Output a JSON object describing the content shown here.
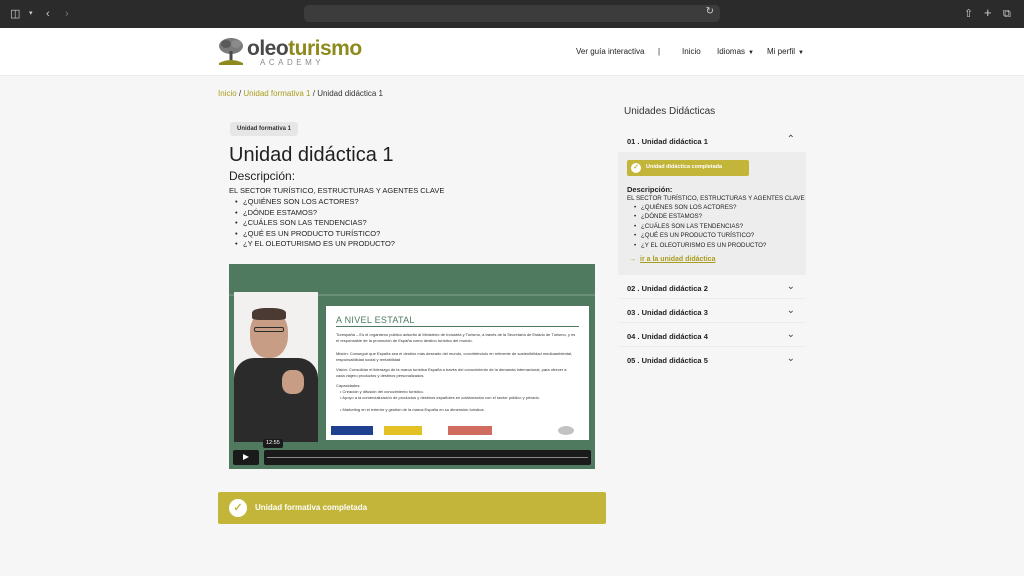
{
  "header": {
    "logo": {
      "part1": "oleo",
      "part2": "turismo",
      "sub": "ACADEMY"
    },
    "nav": {
      "guide": "Ver guía interactiva",
      "separator": "|",
      "home": "Inicio",
      "languages": "Idiomas",
      "profile": "Mi perfil"
    }
  },
  "breadcrumb": {
    "home": "Inicio",
    "sep1": " / ",
    "unit": "Unidad formativa 1",
    "sep2": " / ",
    "current": "Unidad didáctica 1"
  },
  "main": {
    "pill": "Unidad formativa 1",
    "title": "Unidad didáctica 1",
    "desc_label": "Descripción:",
    "desc_heading": "EL SECTOR TURÍSTICO, ESTRUCTURAS Y AGENTES CLAVE",
    "desc_items": [
      "¿QUIÉNES SON LOS ACTORES?",
      "¿DÓNDE ESTAMOS?",
      "¿CUÁLES SON LAS TENDENCIAS?",
      "¿QUÉ ES UN PRODUCTO TURÍSTICO?",
      "¿Y EL OLEOTURISMO ES UN PRODUCTO?"
    ],
    "video": {
      "time": "12:55",
      "slide_title": "A NIVEL ESTATAL",
      "p1": "Turespaña – Es el organismo público adscrito al Ministerio de Industria y Turismo, a través de la Secretaría de Estado de Turismo, y es el responsable de la promoción de España como destino turístico del mundo.",
      "p2": "Misión: Conseguir que España sea el destino más deseado del mundo, convirtiéndolo en referente de sostenibilidad medioambiental, responsabilidad social y rentabilidad",
      "p3": "Visión: Consolidar el liderazgo de la marca turística España a través del conocimiento de la demanda internacional, para ofrecer a cada viajero productos y destinos personalizados.",
      "p4_head": "Capacidades:",
      "p4_items": [
        "Creación y difusión del conocimiento turístico.",
        "Apoyo a la comercialización de productos y destinos españoles en colaboración con el sector público y privado.",
        "Marketing en el exterior y gestión de la marca España en su dimensión turística."
      ]
    },
    "completed": "Unidad formativa completada"
  },
  "sidebar": {
    "title": "Unidades Didácticas",
    "items": [
      {
        "label": "01 . Unidad didáctica 1"
      },
      {
        "label": "02 . Unidad didáctica 2"
      },
      {
        "label": "03 . Unidad didáctica 3"
      },
      {
        "label": "04 . Unidad didáctica 4"
      },
      {
        "label": "05 . Unidad didáctica 5"
      }
    ],
    "panel": {
      "badge": "Unidad didáctica completada",
      "desc_label": "Descripción:",
      "desc_heading": "EL SECTOR TURÍSTICO, ESTRUCTURAS Y AGENTES CLAVE",
      "items": [
        "¿QUIÉNES SON LOS ACTORES?",
        "¿DÓNDE ESTAMOS?",
        "¿CUÁLES SON LAS TENDENCIAS?",
        "¿QUÉ ES UN PRODUCTO TURÍSTICO?",
        "¿Y EL OLEOTURISMO ES UN PRODUCTO?"
      ],
      "link": "ir a la unidad didáctica"
    }
  },
  "colors": {
    "accent": "#c2b53a",
    "link": "#a99d1c",
    "video_bg": "#4f7a60"
  }
}
